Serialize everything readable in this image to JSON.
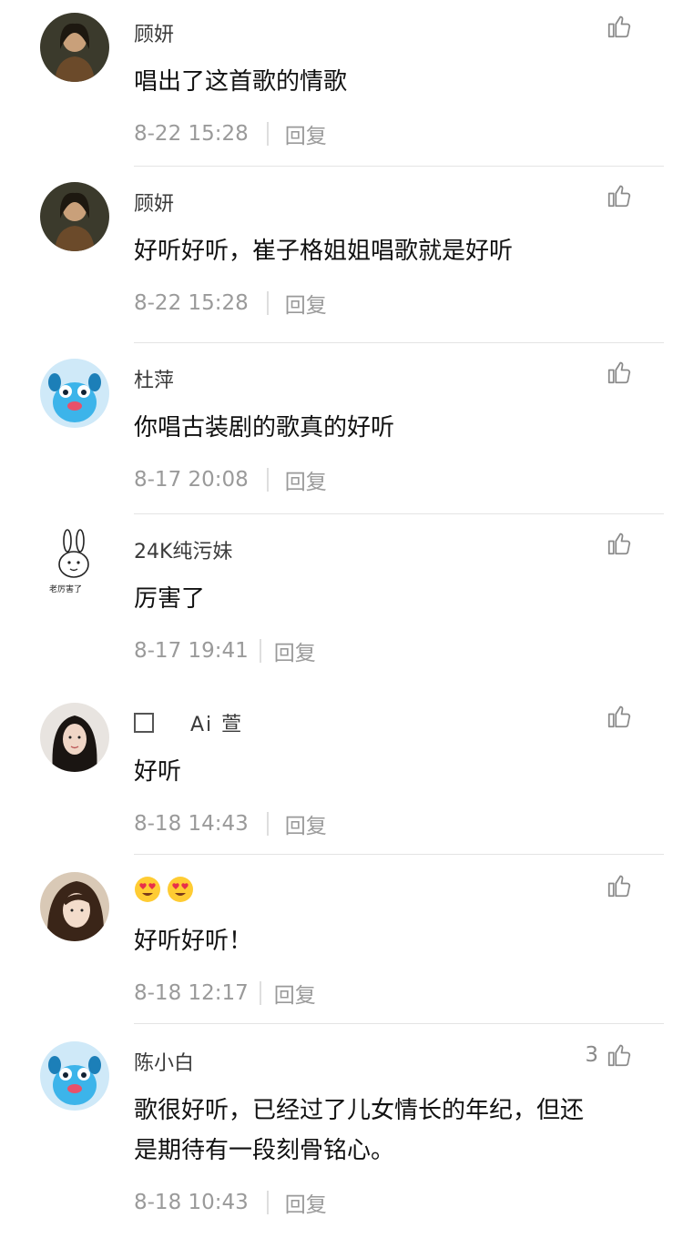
{
  "comments": [
    {
      "username": "顾妍",
      "text": "唱出了这首歌的情歌",
      "time": "8-22 15:28",
      "reply": "回复",
      "likes": ""
    },
    {
      "username": "顾妍",
      "text": "好听好听，崔子格姐姐唱歌就是好听",
      "time": "8-22 15:28",
      "reply": "回复",
      "likes": ""
    },
    {
      "username": "杜萍",
      "text": "你唱古装剧的歌真的好听",
      "time": "8-17 20:08",
      "reply": "回复",
      "likes": ""
    },
    {
      "username": "24K纯污妹",
      "text": "厉害了",
      "time": "8-17 19:41",
      "reply": "回复",
      "likes": ""
    },
    {
      "username": "Ai 萱",
      "text": "好听",
      "time": "8-18 14:43",
      "reply": "回复",
      "likes": ""
    },
    {
      "username": "",
      "text": "好听好听！",
      "time": "8-18 12:17",
      "reply": "回复",
      "likes": ""
    },
    {
      "username": "陈小白",
      "text_line1": "歌很好听，已经过了儿女情长的年纪，但还",
      "text_line2": "是期待有一段刻骨铭心。",
      "time": "8-18 10:43",
      "reply": "回复",
      "likes": "3"
    }
  ],
  "avatar_sticker_text": "老厉害了",
  "icons": {
    "like": "thumbs-up-icon",
    "heart_eyes": "heart-eyes-emoji"
  },
  "colors": {
    "text": "#111111",
    "meta": "#9a9a9a",
    "divider": "#e4e4e4"
  }
}
